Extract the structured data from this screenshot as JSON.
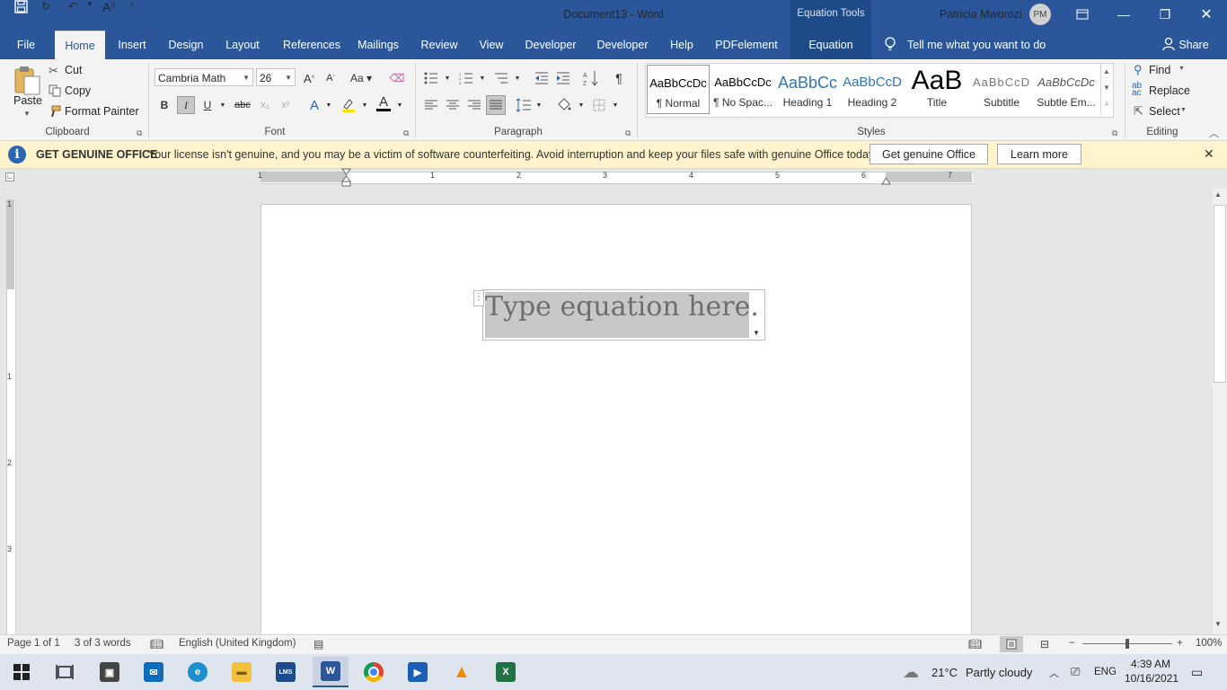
{
  "window": {
    "doc_title": "Document13  -  Word",
    "context_tool": "Equation Tools",
    "user_name": "Patricia Mworozi",
    "user_initials": "PM"
  },
  "qat": {
    "icons": [
      "save-icon",
      "autosave-icon",
      "undo-icon",
      "read-aloud-icon",
      "customize-icon"
    ]
  },
  "tabs": [
    "File",
    "Home",
    "Insert",
    "Design",
    "Layout",
    "References",
    "Mailings",
    "Review",
    "View",
    "Developer",
    "Developer",
    "Help",
    "PDFelement",
    "Equation"
  ],
  "tellme": "Tell me what you want to do",
  "share": "Share",
  "clipboard": {
    "paste": "Paste",
    "cut": "Cut",
    "copy": "Copy",
    "format_painter": "Format Painter",
    "label": "Clipboard"
  },
  "font": {
    "family": "Cambria Math",
    "size": "26",
    "label": "Font"
  },
  "paragraph": {
    "label": "Paragraph"
  },
  "styles": {
    "label": "Styles",
    "items": [
      {
        "preview": "AaBbCcDc",
        "name": "¶ Normal"
      },
      {
        "preview": "AaBbCcDc",
        "name": "¶ No Spac..."
      },
      {
        "preview": "AaBbCc",
        "name": "Heading 1"
      },
      {
        "preview": "AaBbCcD",
        "name": "Heading 2"
      },
      {
        "preview": "AaB",
        "name": "Title"
      },
      {
        "preview": "AaBbCcD",
        "name": "Subtitle"
      },
      {
        "preview": "AaBbCcDc",
        "name": "Subtle Em..."
      }
    ]
  },
  "editing": {
    "find": "Find",
    "replace": "Replace",
    "select": "Select",
    "label": "Editing"
  },
  "infobar": {
    "title": "GET GENUINE OFFICE",
    "message": "Your license isn't genuine, and you may be a victim of software counterfeiting. Avoid interruption and keep your files safe with genuine Office today.",
    "btn_genuine": "Get genuine Office",
    "btn_learn": "Learn more"
  },
  "ruler": {
    "numbers": [
      "1",
      "1",
      "2",
      "3",
      "4",
      "5",
      "6",
      "7"
    ]
  },
  "vruler": {
    "numbers": [
      "1",
      "1",
      "2",
      "3"
    ]
  },
  "document": {
    "equation_placeholder": "Type equation here."
  },
  "status": {
    "page": "Page 1 of 1",
    "words": "3 of 3 words",
    "language": "English (United Kingdom)",
    "zoom": "100%"
  },
  "taskbar": {
    "weather_temp": "21°C",
    "weather_desc": "Partly cloudy",
    "lang": "ENG",
    "time": "4:39 AM",
    "date": "10/16/2021"
  }
}
